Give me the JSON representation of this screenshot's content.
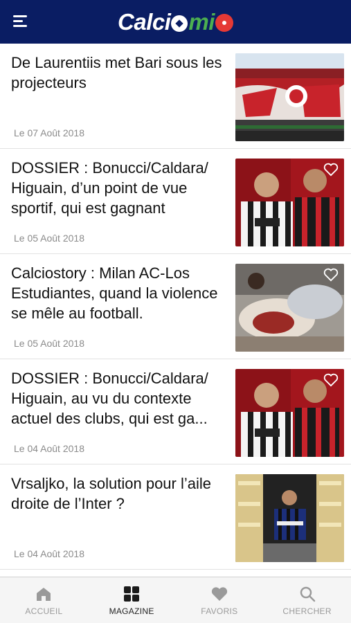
{
  "header": {
    "logo_text_1": "Calci",
    "logo_text_2": "mi",
    "menu_icon": "hamburger-menu-icon",
    "brand_color": "#0a1d63"
  },
  "articles": [
    {
      "title": "De Laurentiis met Bari sous les projecteurs",
      "date": "Le 07 Août 2018",
      "favorite": false
    },
    {
      "title": "DOSSIER : Bonucci/Caldara/ Higuain, d’un point de vue sportif, qui est gagnant",
      "date": "Le 05 Août 2018",
      "favorite": false
    },
    {
      "title": "Calciostory : Milan AC-Los Estudiantes, quand la violence se mêle au football.",
      "date": "Le 05 Août 2018",
      "favorite": false
    },
    {
      "title": "DOSSIER : Bonucci/Caldara/ Higuain, au vu du contexte actuel des clubs, qui est ga...",
      "date": "Le 04 Août 2018",
      "favorite": false
    },
    {
      "title": "Vrsaljko, la solution pour l’aile droite de l’Inter ?",
      "date": "Le 04 Août 2018",
      "favorite": false
    }
  ],
  "tabs": [
    {
      "label": "ACCUEIL",
      "icon": "home-icon",
      "active": false
    },
    {
      "label": "MAGAZINE",
      "icon": "grid-icon",
      "active": true
    },
    {
      "label": "FAVORIS",
      "icon": "heart-icon",
      "active": false
    },
    {
      "label": "CHERCHER",
      "icon": "search-icon",
      "active": false
    }
  ]
}
